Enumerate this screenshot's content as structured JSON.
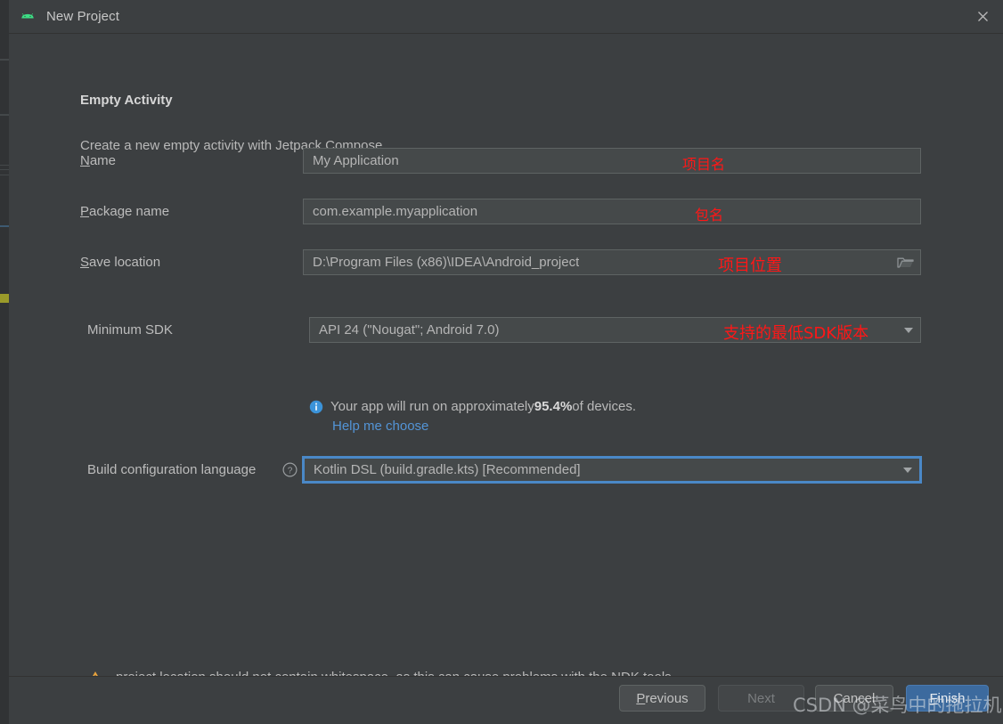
{
  "window": {
    "title": "New Project",
    "app_icon": "android-robot-icon",
    "close_icon": "close-icon"
  },
  "header": {
    "heading": "Empty Activity",
    "subheading": "Create a new empty activity with Jetpack Compose"
  },
  "form": {
    "name": {
      "label_mnemonic": "N",
      "label_rest": "ame",
      "value": "My Application",
      "annotation": "项目名"
    },
    "package_name": {
      "label_mnemonic": "P",
      "label_rest": "ackage name",
      "value": "com.example.myapplication",
      "annotation": "包名"
    },
    "save_location": {
      "label_mnemonic": "S",
      "label_rest": "ave location",
      "value": "D:\\Program Files (x86)\\IDEA\\Android_project",
      "annotation": "项目位置",
      "browse_icon": "folder-icon"
    },
    "minimum_sdk": {
      "label": "Minimum SDK",
      "value": "API 24 (\"Nougat\"; Android 7.0)",
      "annotation": "支持的最低SDK版本",
      "dropdown_icon": "chevron-down-icon"
    },
    "device_info": {
      "icon": "info-icon",
      "text_before": "Your app will run on approximately ",
      "percent": "95.4%",
      "text_after": " of devices.",
      "link": "Help me choose"
    },
    "build_language": {
      "label": "Build configuration language",
      "help_icon": "help-circle-icon",
      "value": "Kotlin DSL (build.gradle.kts) [Recommended]",
      "dropdown_icon": "chevron-down-icon"
    }
  },
  "warning": {
    "icon": "warning-triangle-icon",
    "text": "project location should not contain whitespace, as this can cause problems with the NDK tools."
  },
  "footer": {
    "previous": {
      "mnemonic": "P",
      "rest": "revious"
    },
    "next": "Next",
    "cancel": "Cancel",
    "finish": {
      "mnemonic": "F",
      "rest": "inish"
    }
  },
  "watermark": "CSDN @菜鸟中的拖拉机",
  "colors": {
    "background": "#3c3f41",
    "field": "#45494a",
    "accent_blue": "#4a88c7",
    "link_blue": "#5394d6",
    "primary_button": "#3c6a9e",
    "annotation_red": "#ff1717",
    "warning_orange": "#e8a33d",
    "android_green": "#3ddc84"
  }
}
